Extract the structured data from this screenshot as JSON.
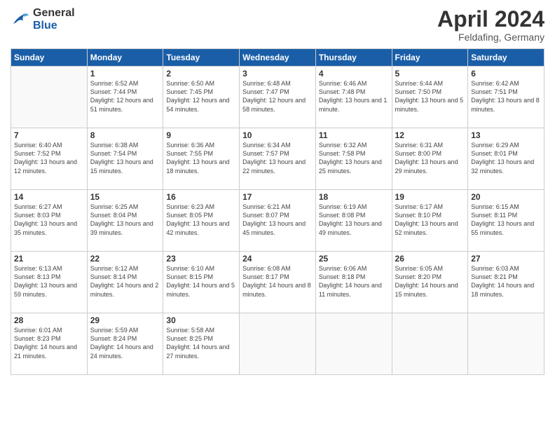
{
  "header": {
    "logo_general": "General",
    "logo_blue": "Blue",
    "month_title": "April 2024",
    "location": "Feldafing, Germany"
  },
  "days_of_week": [
    "Sunday",
    "Monday",
    "Tuesday",
    "Wednesday",
    "Thursday",
    "Friday",
    "Saturday"
  ],
  "weeks": [
    [
      {
        "day": "",
        "sunrise": "",
        "sunset": "",
        "daylight": ""
      },
      {
        "day": "1",
        "sunrise": "Sunrise: 6:52 AM",
        "sunset": "Sunset: 7:44 PM",
        "daylight": "Daylight: 12 hours and 51 minutes."
      },
      {
        "day": "2",
        "sunrise": "Sunrise: 6:50 AM",
        "sunset": "Sunset: 7:45 PM",
        "daylight": "Daylight: 12 hours and 54 minutes."
      },
      {
        "day": "3",
        "sunrise": "Sunrise: 6:48 AM",
        "sunset": "Sunset: 7:47 PM",
        "daylight": "Daylight: 12 hours and 58 minutes."
      },
      {
        "day": "4",
        "sunrise": "Sunrise: 6:46 AM",
        "sunset": "Sunset: 7:48 PM",
        "daylight": "Daylight: 13 hours and 1 minute."
      },
      {
        "day": "5",
        "sunrise": "Sunrise: 6:44 AM",
        "sunset": "Sunset: 7:50 PM",
        "daylight": "Daylight: 13 hours and 5 minutes."
      },
      {
        "day": "6",
        "sunrise": "Sunrise: 6:42 AM",
        "sunset": "Sunset: 7:51 PM",
        "daylight": "Daylight: 13 hours and 8 minutes."
      }
    ],
    [
      {
        "day": "7",
        "sunrise": "Sunrise: 6:40 AM",
        "sunset": "Sunset: 7:52 PM",
        "daylight": "Daylight: 13 hours and 12 minutes."
      },
      {
        "day": "8",
        "sunrise": "Sunrise: 6:38 AM",
        "sunset": "Sunset: 7:54 PM",
        "daylight": "Daylight: 13 hours and 15 minutes."
      },
      {
        "day": "9",
        "sunrise": "Sunrise: 6:36 AM",
        "sunset": "Sunset: 7:55 PM",
        "daylight": "Daylight: 13 hours and 18 minutes."
      },
      {
        "day": "10",
        "sunrise": "Sunrise: 6:34 AM",
        "sunset": "Sunset: 7:57 PM",
        "daylight": "Daylight: 13 hours and 22 minutes."
      },
      {
        "day": "11",
        "sunrise": "Sunrise: 6:32 AM",
        "sunset": "Sunset: 7:58 PM",
        "daylight": "Daylight: 13 hours and 25 minutes."
      },
      {
        "day": "12",
        "sunrise": "Sunrise: 6:31 AM",
        "sunset": "Sunset: 8:00 PM",
        "daylight": "Daylight: 13 hours and 29 minutes."
      },
      {
        "day": "13",
        "sunrise": "Sunrise: 6:29 AM",
        "sunset": "Sunset: 8:01 PM",
        "daylight": "Daylight: 13 hours and 32 minutes."
      }
    ],
    [
      {
        "day": "14",
        "sunrise": "Sunrise: 6:27 AM",
        "sunset": "Sunset: 8:03 PM",
        "daylight": "Daylight: 13 hours and 35 minutes."
      },
      {
        "day": "15",
        "sunrise": "Sunrise: 6:25 AM",
        "sunset": "Sunset: 8:04 PM",
        "daylight": "Daylight: 13 hours and 39 minutes."
      },
      {
        "day": "16",
        "sunrise": "Sunrise: 6:23 AM",
        "sunset": "Sunset: 8:05 PM",
        "daylight": "Daylight: 13 hours and 42 minutes."
      },
      {
        "day": "17",
        "sunrise": "Sunrise: 6:21 AM",
        "sunset": "Sunset: 8:07 PM",
        "daylight": "Daylight: 13 hours and 45 minutes."
      },
      {
        "day": "18",
        "sunrise": "Sunrise: 6:19 AM",
        "sunset": "Sunset: 8:08 PM",
        "daylight": "Daylight: 13 hours and 49 minutes."
      },
      {
        "day": "19",
        "sunrise": "Sunrise: 6:17 AM",
        "sunset": "Sunset: 8:10 PM",
        "daylight": "Daylight: 13 hours and 52 minutes."
      },
      {
        "day": "20",
        "sunrise": "Sunrise: 6:15 AM",
        "sunset": "Sunset: 8:11 PM",
        "daylight": "Daylight: 13 hours and 55 minutes."
      }
    ],
    [
      {
        "day": "21",
        "sunrise": "Sunrise: 6:13 AM",
        "sunset": "Sunset: 8:13 PM",
        "daylight": "Daylight: 13 hours and 59 minutes."
      },
      {
        "day": "22",
        "sunrise": "Sunrise: 6:12 AM",
        "sunset": "Sunset: 8:14 PM",
        "daylight": "Daylight: 14 hours and 2 minutes."
      },
      {
        "day": "23",
        "sunrise": "Sunrise: 6:10 AM",
        "sunset": "Sunset: 8:15 PM",
        "daylight": "Daylight: 14 hours and 5 minutes."
      },
      {
        "day": "24",
        "sunrise": "Sunrise: 6:08 AM",
        "sunset": "Sunset: 8:17 PM",
        "daylight": "Daylight: 14 hours and 8 minutes."
      },
      {
        "day": "25",
        "sunrise": "Sunrise: 6:06 AM",
        "sunset": "Sunset: 8:18 PM",
        "daylight": "Daylight: 14 hours and 11 minutes."
      },
      {
        "day": "26",
        "sunrise": "Sunrise: 6:05 AM",
        "sunset": "Sunset: 8:20 PM",
        "daylight": "Daylight: 14 hours and 15 minutes."
      },
      {
        "day": "27",
        "sunrise": "Sunrise: 6:03 AM",
        "sunset": "Sunset: 8:21 PM",
        "daylight": "Daylight: 14 hours and 18 minutes."
      }
    ],
    [
      {
        "day": "28",
        "sunrise": "Sunrise: 6:01 AM",
        "sunset": "Sunset: 8:23 PM",
        "daylight": "Daylight: 14 hours and 21 minutes."
      },
      {
        "day": "29",
        "sunrise": "Sunrise: 5:59 AM",
        "sunset": "Sunset: 8:24 PM",
        "daylight": "Daylight: 14 hours and 24 minutes."
      },
      {
        "day": "30",
        "sunrise": "Sunrise: 5:58 AM",
        "sunset": "Sunset: 8:25 PM",
        "daylight": "Daylight: 14 hours and 27 minutes."
      },
      {
        "day": "",
        "sunrise": "",
        "sunset": "",
        "daylight": ""
      },
      {
        "day": "",
        "sunrise": "",
        "sunset": "",
        "daylight": ""
      },
      {
        "day": "",
        "sunrise": "",
        "sunset": "",
        "daylight": ""
      },
      {
        "day": "",
        "sunrise": "",
        "sunset": "",
        "daylight": ""
      }
    ]
  ]
}
